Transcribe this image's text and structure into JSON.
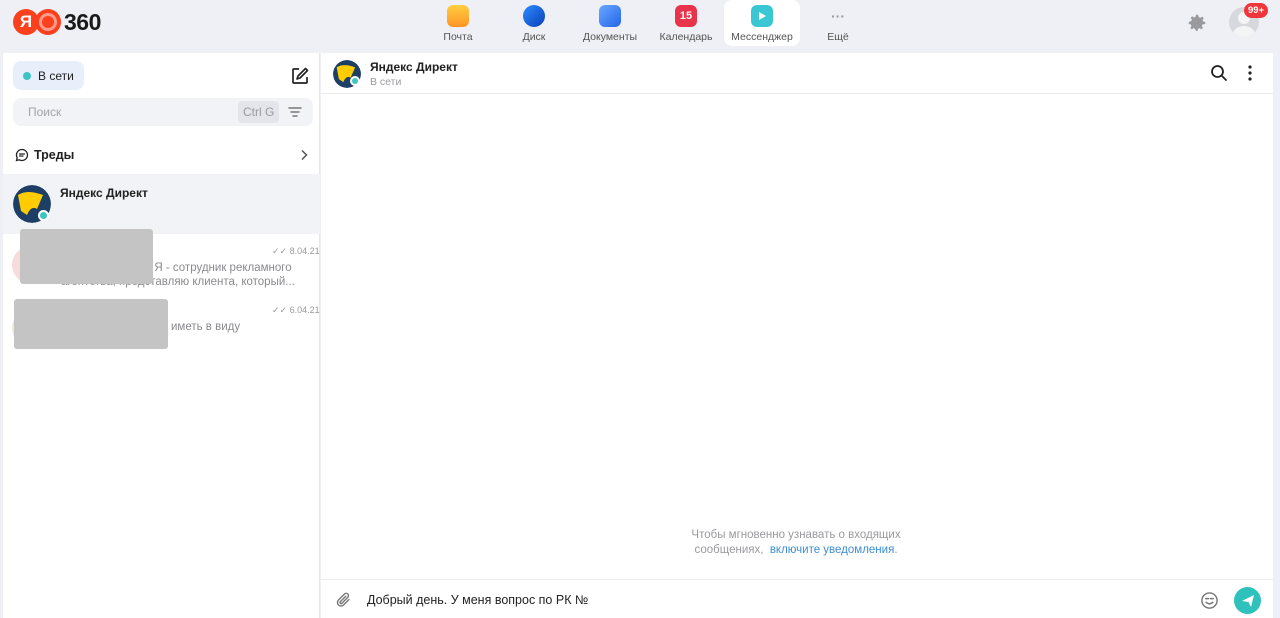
{
  "brand": {
    "ya": "Я",
    "num": "360"
  },
  "services": [
    {
      "label": "Почта",
      "icon": "mail-icon"
    },
    {
      "label": "Диск",
      "icon": "disk-icon"
    },
    {
      "label": "Документы",
      "icon": "documents-icon"
    },
    {
      "label": "Календарь",
      "icon": "calendar-icon",
      "icon_text": "15"
    },
    {
      "label": "Мессенджер",
      "icon": "messenger-icon",
      "active": true
    },
    {
      "label": "Ещё",
      "icon": "more-icon",
      "icon_text": "···"
    }
  ],
  "header": {
    "notifications_badge": "99+"
  },
  "sidebar": {
    "status": "В сети",
    "search_placeholder": "Поиск",
    "search_shortcut": "Ctrl G",
    "threads_label": "Треды",
    "chats": [
      {
        "name": "Яндекс Директ",
        "active": true
      },
      {
        "time": "8.04.21",
        "preview_line1": "! Я - сотрудник рекламного",
        "preview_line2": "агентства, представляю клиента, который..."
      },
      {
        "time": "6.04.21",
        "preview_line1": "иметь в виду"
      }
    ]
  },
  "conversation": {
    "title": "Яндекс Директ",
    "status": "В сети",
    "notice_line1": "Чтобы мгновенно узнавать о входящих",
    "notice_line2": "сообщениях,",
    "notice_link": "включите уведомления",
    "notice_end": ".",
    "composer_text": "Добрый день. У меня вопрос по РК №"
  },
  "colors": {
    "accent": "#2fc2bc",
    "online": "#3bc6c4",
    "link": "#3c8dd6",
    "badge": "#f0353b",
    "brand": "#fc3f1d"
  }
}
